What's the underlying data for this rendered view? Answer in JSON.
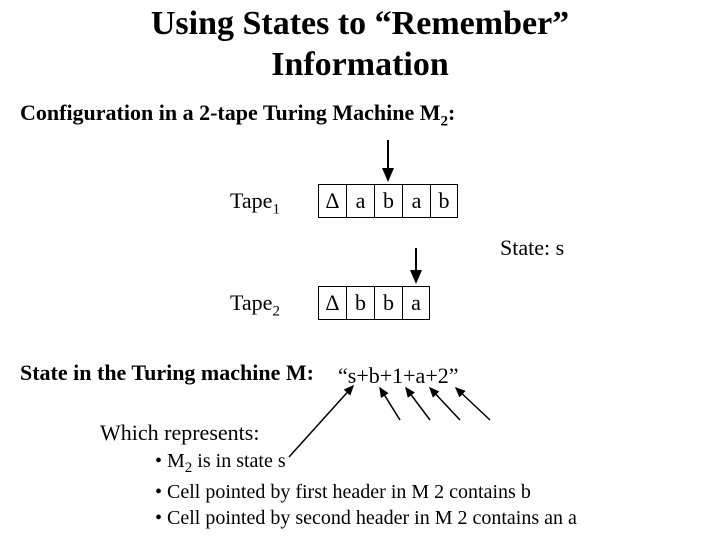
{
  "title_line1": "Using States to “Remember”",
  "title_line2": "Information",
  "subtitle_prefix": "Configuration in a 2-tape Turing Machine M",
  "subtitle_sub": "2",
  "subtitle_suffix": ":",
  "tape1_label_prefix": "Tape",
  "tape1_label_sub": "1",
  "tape2_label_prefix": "Tape",
  "tape2_label_sub": "2",
  "tape1_cells": [
    "Δ",
    "a",
    "b",
    "a",
    "b"
  ],
  "tape2_cells": [
    "Δ",
    "b",
    "b",
    "a"
  ],
  "state_s_label": "State: s",
  "state_line_label": "State in the Turing machine M:",
  "state_string": "“s+b+1+a+2”",
  "repr_label": "Which represents:",
  "bullet1_prefix": "• M",
  "bullet1_sub": "2",
  "bullet1_suffix": " is in state s",
  "bullet2": "• Cell pointed by first header in M 2 contains b",
  "bullet3": "• Cell pointed by second header in M 2 contains an a"
}
